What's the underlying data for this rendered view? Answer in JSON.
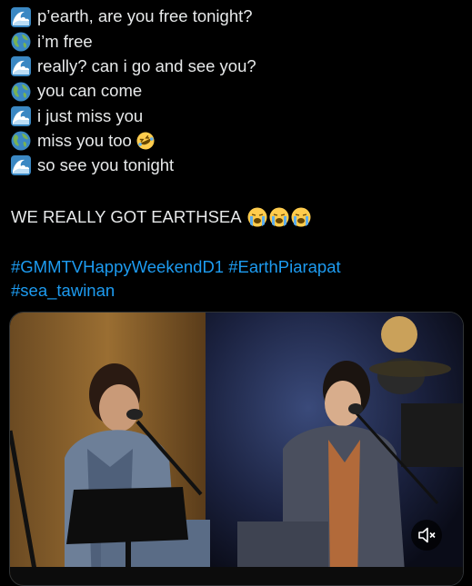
{
  "tweet": {
    "lines": [
      {
        "speaker": "wave-icon",
        "text": "p’earth, are you free tonight?"
      },
      {
        "speaker": "globe-icon",
        "text": "i’m free"
      },
      {
        "speaker": "wave-icon",
        "text": "really? can i go and see you?"
      },
      {
        "speaker": "globe-icon",
        "text": "you can come"
      },
      {
        "speaker": "wave-icon",
        "text": "i just miss you"
      },
      {
        "speaker": "globe-icon",
        "text": "miss you too"
      },
      {
        "speaker": "wave-icon",
        "text": "so see you tonight"
      }
    ],
    "headline": "WE REALLY GOT EARTHSEA",
    "headline_emoji": "loudly-crying-face-icon x3",
    "hashtags_line1": [
      "#GMMTVHappyWeekendD1",
      "#EarthPiarapat"
    ],
    "hashtags_line2": [
      "#sea_tawinan"
    ]
  },
  "media": {
    "type": "video",
    "mute_icon": "speaker-muted-icon"
  },
  "colors": {
    "background": "#000000",
    "text": "#e7e9ea",
    "link": "#1d9bf0"
  }
}
